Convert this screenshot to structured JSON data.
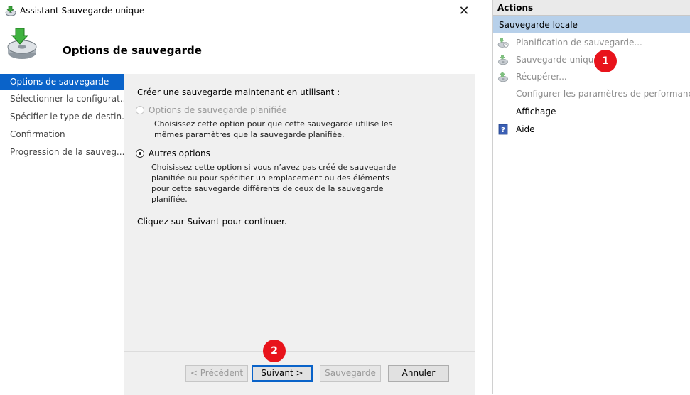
{
  "dialog": {
    "window_title": "Assistant Sauvegarde unique",
    "close_glyph": "✕",
    "header_title": "Options de sauvegarde"
  },
  "nav": {
    "items": [
      {
        "label": "Options de sauvegarde",
        "selected": true
      },
      {
        "label": "Sélectionner la configurat...",
        "selected": false
      },
      {
        "label": "Spécifier le type de destin...",
        "selected": false
      },
      {
        "label": "Confirmation",
        "selected": false
      },
      {
        "label": "Progression de la sauveg...",
        "selected": false
      }
    ]
  },
  "content": {
    "intro": "Créer une sauvegarde maintenant en utilisant :",
    "option1": {
      "label": "Options de sauvegarde planifiée",
      "enabled": false,
      "checked": false,
      "desc": [
        "Choisissez cette option pour que cette sauvegarde utilise les",
        "mêmes paramètres que la sauvegarde planifiée."
      ]
    },
    "option2": {
      "label": "Autres options",
      "enabled": true,
      "checked": true,
      "desc": [
        "Choisissez cette option si vous n’avez pas créé de sauvegarde",
        "planifiée ou pour spécifier un emplacement ou des éléments",
        "pour cette sauvegarde différents de ceux de la sauvegarde",
        "planifiée."
      ]
    },
    "footer_text": "Cliquez sur Suivant pour continuer."
  },
  "buttons": {
    "previous": "< Précédent",
    "next": "Suivant >",
    "backup": "Sauvegarde",
    "cancel": "Annuler"
  },
  "actions": {
    "header": "Actions",
    "section": "Sauvegarde locale",
    "items": [
      {
        "label": "Planification de sauvegarde...",
        "icon": "backup-schedule-icon",
        "enabled": false
      },
      {
        "label": "Sauvegarde unique...",
        "icon": "backup-once-icon",
        "enabled": false
      },
      {
        "label": "Récupérer...",
        "icon": "recover-icon",
        "enabled": false
      },
      {
        "label": "Configurer les paramètres de performances...",
        "icon": "",
        "enabled": false
      },
      {
        "label": "Affichage",
        "icon": "",
        "enabled": true
      },
      {
        "label": "Aide",
        "icon": "help-icon",
        "enabled": true
      }
    ]
  },
  "annotations": {
    "badge1": "1",
    "badge2": "2"
  },
  "colors": {
    "selection": "#0a63c9",
    "section_bg": "#b7d0ea",
    "badge": "#e8131b"
  }
}
